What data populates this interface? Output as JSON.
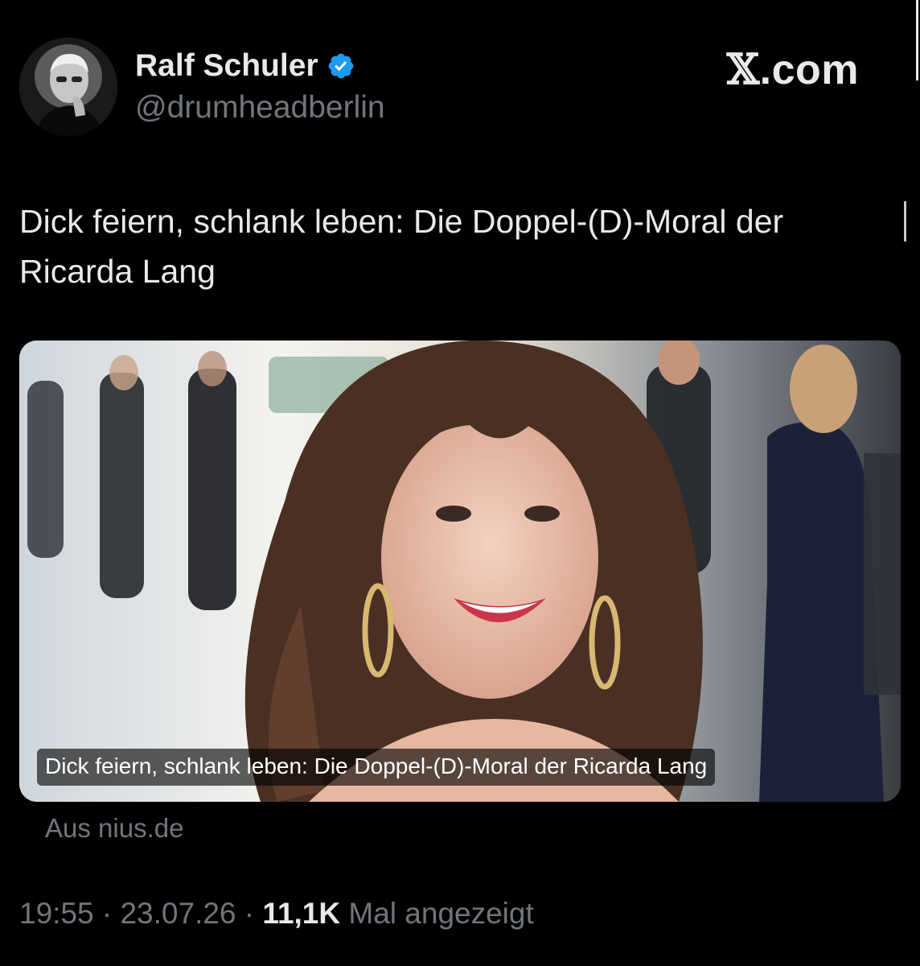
{
  "author": {
    "name": "Ralf Schuler",
    "handle": "@drumheadberlin",
    "verified": true,
    "verified_color": "#1d9bf0"
  },
  "brand": {
    "x_glyph": "𝕏",
    "suffix": ".com"
  },
  "tweet": {
    "text": "Dick feiern, schlank leben: Die Doppel-(D)-Moral der Ricarda Lang"
  },
  "card": {
    "image_icon": "photo-icon",
    "caption": "Dick feiern, schlank leben: Die Doppel-(D)-Moral der Ricarda Lang",
    "source": "Aus nius.de"
  },
  "meta": {
    "time": "19:55",
    "separator": "·",
    "date": "23.07.26",
    "views_count": "11,1K",
    "views_label": "Mal angezeigt"
  },
  "colors": {
    "background": "#000000",
    "primary_text": "#e7e9ea",
    "secondary_text": "#71767b"
  }
}
